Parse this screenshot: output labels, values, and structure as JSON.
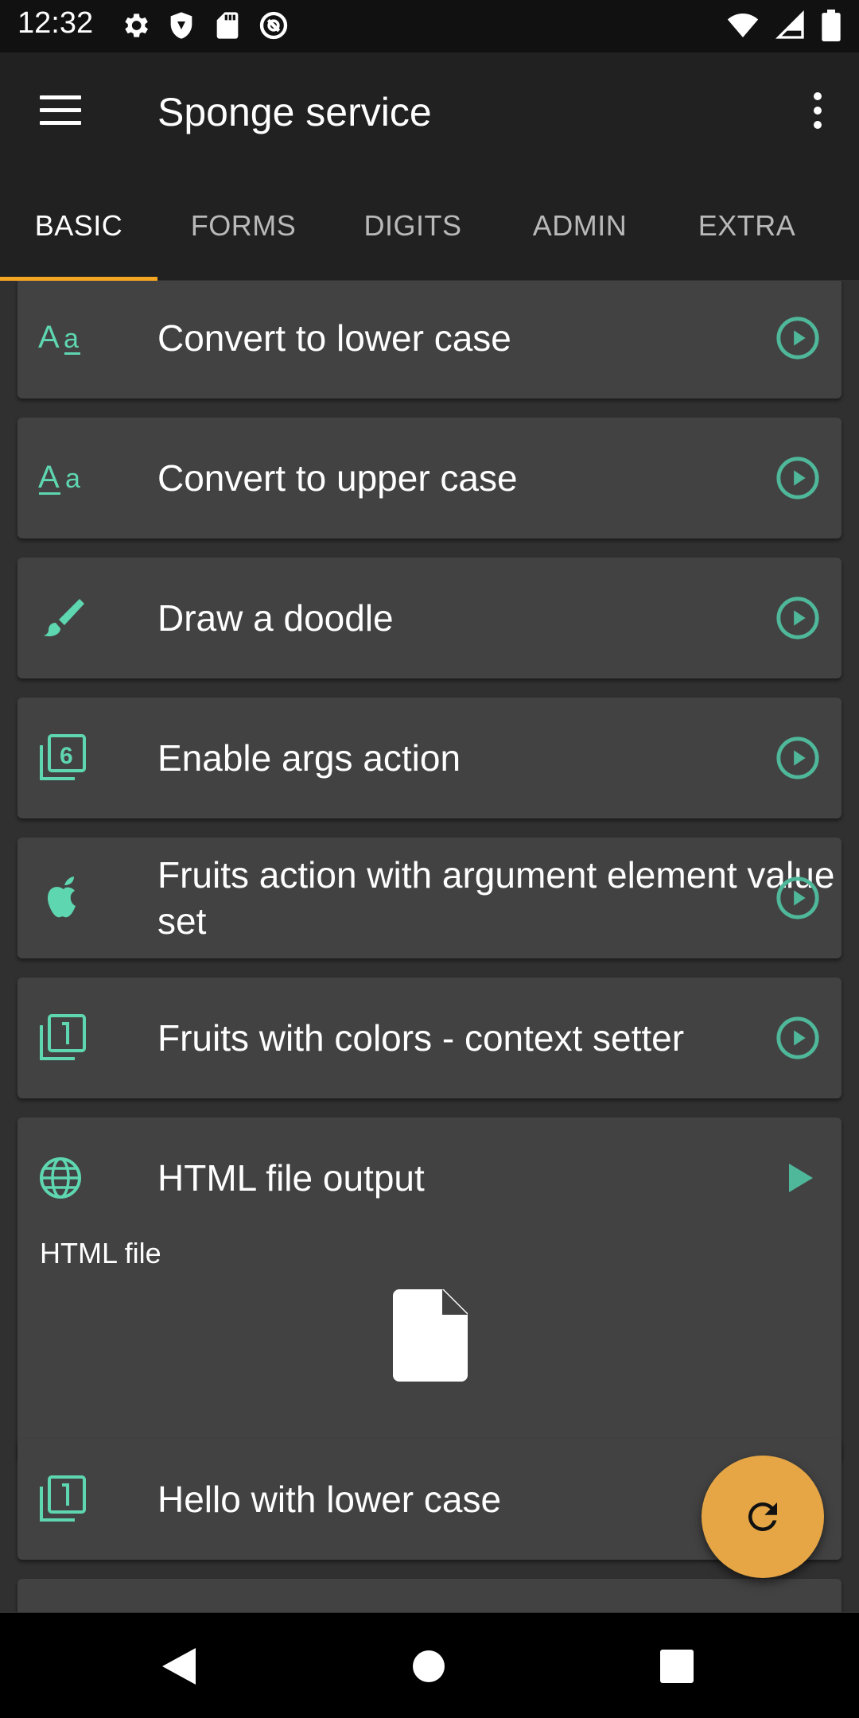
{
  "status_bar": {
    "time": "12:32"
  },
  "app_bar": {
    "title": "Sponge service"
  },
  "tabs": [
    {
      "label": "BASIC",
      "active": true
    },
    {
      "label": "FORMS",
      "active": false
    },
    {
      "label": "DIGITS",
      "active": false
    },
    {
      "label": "ADMIN",
      "active": false
    },
    {
      "label": "EXTRA",
      "active": false
    }
  ],
  "actions": [
    {
      "label": "Convert to lower case",
      "icon": "format-lowercase-icon"
    },
    {
      "label": "Convert to upper case",
      "icon": "format-uppercase-icon"
    },
    {
      "label": "Draw a doodle",
      "icon": "brush-icon"
    },
    {
      "label": "Enable args action",
      "icon": "filter-6-icon"
    },
    {
      "label": "Fruits action with argument element value set",
      "icon": "apple-icon"
    },
    {
      "label": "Fruits with colors - context setter",
      "icon": "filter-1-icon"
    },
    {
      "label": "HTML file output",
      "icon": "globe-icon",
      "result_label": "HTML file"
    },
    {
      "label": "Hello with lower case",
      "icon": "filter-1-icon"
    }
  ],
  "colors": {
    "accent": "#5ed6b0",
    "tab_indicator": "#f5a623",
    "fab": "#e6a645",
    "card": "#424242",
    "background": "#303030",
    "app_bar": "#212121"
  }
}
